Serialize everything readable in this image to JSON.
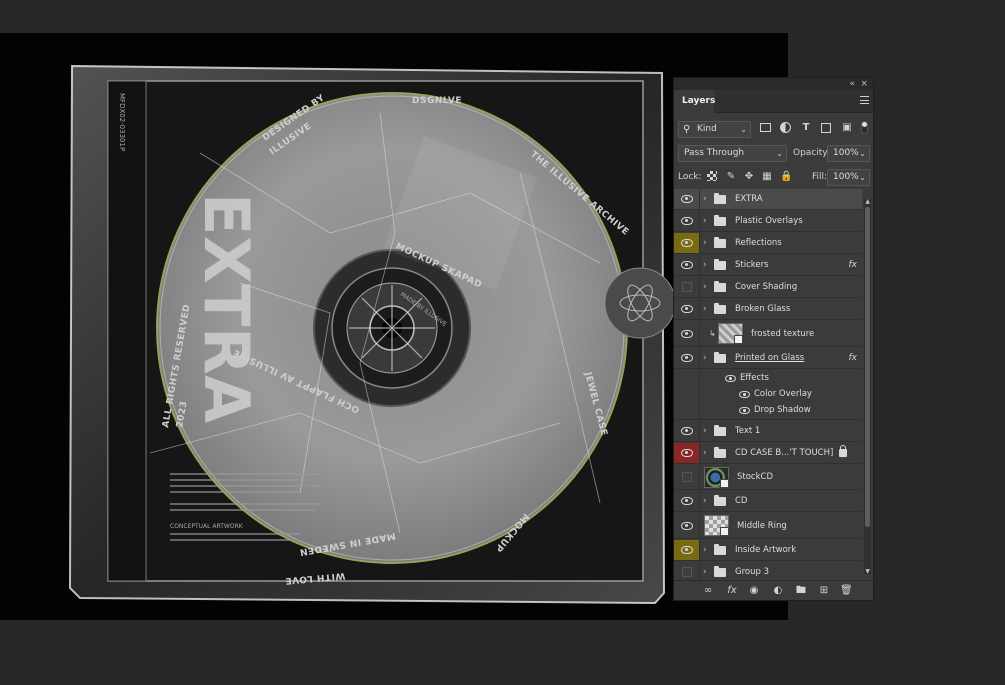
{
  "panel": {
    "title": "Layers",
    "topbar": {
      "collapse_label": "«",
      "close_label": "×"
    },
    "filter": {
      "kind_value": "Kind",
      "filter_icons": [
        "image-filter-icon",
        "adjustment-filter-icon",
        "type-filter-icon",
        "shape-filter-icon",
        "smart-object-filter-icon"
      ]
    },
    "blend": {
      "mode": "Pass Through",
      "opacity_label": "Opacity:",
      "opacity_value": "100%"
    },
    "lock": {
      "label": "Lock:",
      "fill_label": "Fill:",
      "fill_value": "100%"
    },
    "layers": [
      {
        "name": "EXTRA",
        "type": "group",
        "visible": true,
        "eye_color": "",
        "selected": true
      },
      {
        "name": "Plastic Overlays",
        "type": "group",
        "visible": true,
        "eye_color": ""
      },
      {
        "name": "Reflections",
        "type": "group",
        "visible": true,
        "eye_color": "#7a6a12"
      },
      {
        "name": "Stickers",
        "type": "group",
        "visible": true,
        "eye_color": "",
        "fx": "fx"
      },
      {
        "name": "Cover Shading",
        "type": "group",
        "visible": false,
        "eye_color": ""
      },
      {
        "name": "Broken Glass",
        "type": "group",
        "visible": true,
        "eye_color": ""
      },
      {
        "name": "frosted texture",
        "type": "smart",
        "visible": true,
        "eye_color": ""
      },
      {
        "name": "Printed on Glass",
        "type": "group",
        "visible": true,
        "eye_color": "",
        "fx": "fx"
      },
      {
        "name": "Text 1",
        "type": "group",
        "visible": true,
        "eye_color": ""
      },
      {
        "name": "CD CASE B...'T TOUCH]",
        "type": "group",
        "visible": true,
        "eye_color": "#8a2626",
        "locked": true
      },
      {
        "name": "StockCD",
        "type": "smart",
        "visible": false,
        "eye_color": ""
      },
      {
        "name": "CD",
        "type": "group",
        "visible": true,
        "eye_color": ""
      },
      {
        "name": "Middle Ring",
        "type": "smart",
        "visible": true,
        "eye_color": ""
      },
      {
        "name": "Inside Artwork",
        "type": "group",
        "visible": true,
        "eye_color": "#7a6a12"
      },
      {
        "name": "Group 3",
        "type": "group",
        "visible": false,
        "eye_color": ""
      }
    ],
    "effects": {
      "label": "Effects",
      "items": [
        "Color Overlay",
        "Drop Shadow"
      ]
    },
    "fx_label": "fx",
    "footer_icons": [
      "link-layers-icon",
      "fx-icon",
      "mask-icon",
      "adjustment-layer-icon",
      "new-group-icon",
      "new-layer-icon",
      "trash-icon"
    ]
  },
  "artwork": {
    "spine_title": "EXTRA",
    "designed_by": "DESIGNED BY",
    "illusive": "ILLUSIVE",
    "dsgnlve": "DSGNLVE",
    "archive": "THE ILLUSIVE ARCHIVE",
    "mockup_skapad": "MOCKUP SKAPAD",
    "och_flappt": "OCH FLAPPT AV ILLUSIVE",
    "jewel_case": "JEWEL CASE",
    "mockup": "MOCKUP",
    "made_in": "MADE IN SWEDEN",
    "with_love": "WITH LOVE",
    "rights": "ALL RIGHTS RESERVED",
    "year": "2023",
    "spine_code": "MFDX02-03301P",
    "made_by": "MADE BY ILLUSIVE",
    "conceptual": "CONCEPTUAL ARTWORK"
  }
}
